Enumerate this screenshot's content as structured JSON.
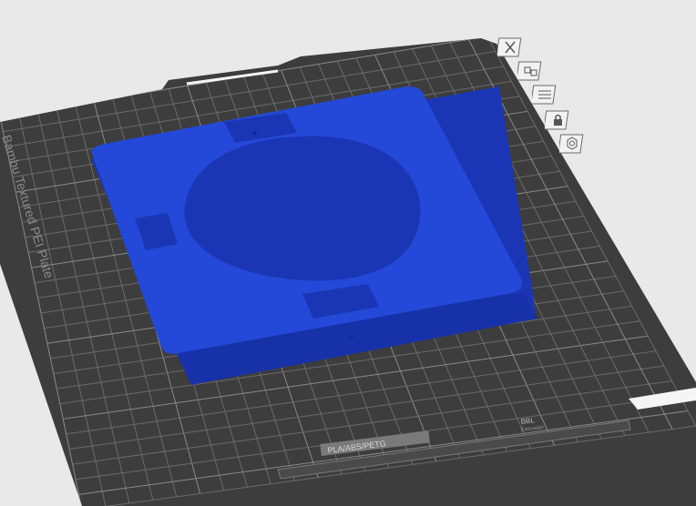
{
  "plate": {
    "name_label": "Bambu Textured PEI Plate",
    "filament_label": "PLA/ABS/PETG",
    "brand_label": "BBL",
    "edition_label": "Extrusion"
  },
  "plate_tools": [
    {
      "name": "delete-plate-icon",
      "label": "Remove plate"
    },
    {
      "name": "auto-arrange-icon",
      "label": "Arrange"
    },
    {
      "name": "orient-icon",
      "label": "Orient"
    },
    {
      "name": "lock-plate-icon",
      "label": "Lock"
    },
    {
      "name": "plate-settings-icon",
      "label": "Plate settings"
    }
  ],
  "colors": {
    "background": "#e9e9e9",
    "plate": "#3d3d3d",
    "grid": "#6b6b6b",
    "model_top": "#2449d8",
    "model_side": "#1a36b5",
    "model_shadow": "#132a91",
    "accent_white": "#f5f5f5"
  }
}
